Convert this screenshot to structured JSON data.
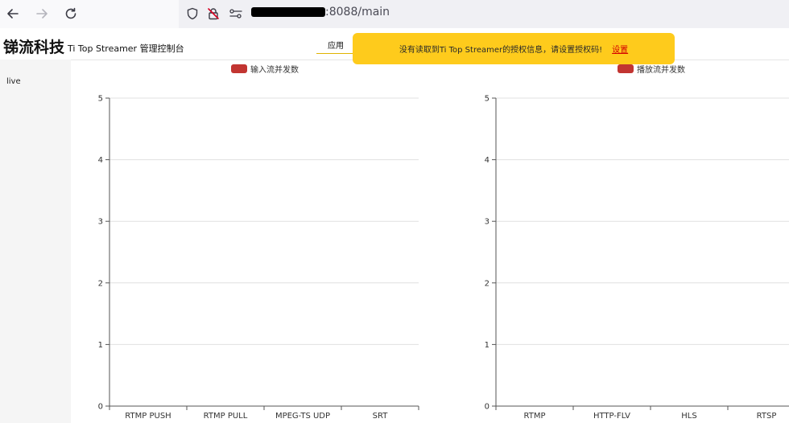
{
  "browser": {
    "url_suffix": ":8088/main"
  },
  "app": {
    "brand": "锑流科技",
    "subtitle": "Ti Top Streamer 管理控制台",
    "tab_apps": "应用"
  },
  "notice": {
    "message": "没有读取到Ti Top Streamer的授权信息，请设置授权码!",
    "link": "设置"
  },
  "sidebar": {
    "items": [
      {
        "label": "live"
      }
    ]
  },
  "colors": {
    "bar": "#c23531",
    "notice_bg": "#fecb1c",
    "link": "#d40000"
  },
  "chart_data": [
    {
      "type": "bar",
      "legend": "输入流并发数",
      "categories": [
        "RTMP PUSH",
        "RTMP PULL",
        "MPEG-TS UDP",
        "SRT"
      ],
      "values": [
        0,
        0,
        0,
        0
      ],
      "yticks": [
        "0",
        "1",
        "2",
        "3",
        "4",
        "5"
      ],
      "ylim": [
        0,
        5
      ],
      "grid": true,
      "legend_position": "top"
    },
    {
      "type": "bar",
      "legend": "播放流并发数",
      "categories": [
        "RTMP",
        "HTTP-FLV",
        "HLS",
        "RTSP"
      ],
      "values": [
        0,
        0,
        0,
        0
      ],
      "yticks": [
        "0",
        "1",
        "2",
        "3",
        "4",
        "5"
      ],
      "ylim": [
        0,
        5
      ],
      "grid": true,
      "legend_position": "top"
    }
  ]
}
